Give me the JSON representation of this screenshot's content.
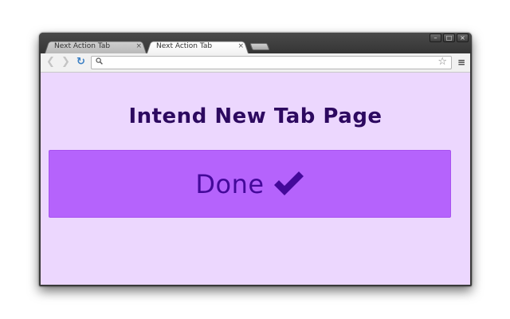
{
  "browser": {
    "tabs": [
      {
        "title": "Next Action Tab",
        "close": "×",
        "active": false
      },
      {
        "title": "Next Action Tab",
        "close": "×",
        "active": true
      }
    ],
    "window_controls": [
      "–",
      "□",
      "×"
    ],
    "nav_icons": {
      "back": "back-arrow-icon",
      "forward": "forward-arrow-icon",
      "reload": "reload-icon"
    },
    "omnibox": {
      "value": "",
      "placeholder": ""
    },
    "icons": {
      "search": "search-icon",
      "bookmark": "star-icon",
      "menu": "hamburger-menu-icon"
    }
  },
  "page": {
    "heading": "Intend New Tab Page",
    "done_button": {
      "label": "Done",
      "icon": "checkmark-icon"
    },
    "colors": {
      "background": "#ecd7fe",
      "button": "#b563fc",
      "button_text": "#44099a",
      "heading_text": "#2d0960"
    }
  }
}
